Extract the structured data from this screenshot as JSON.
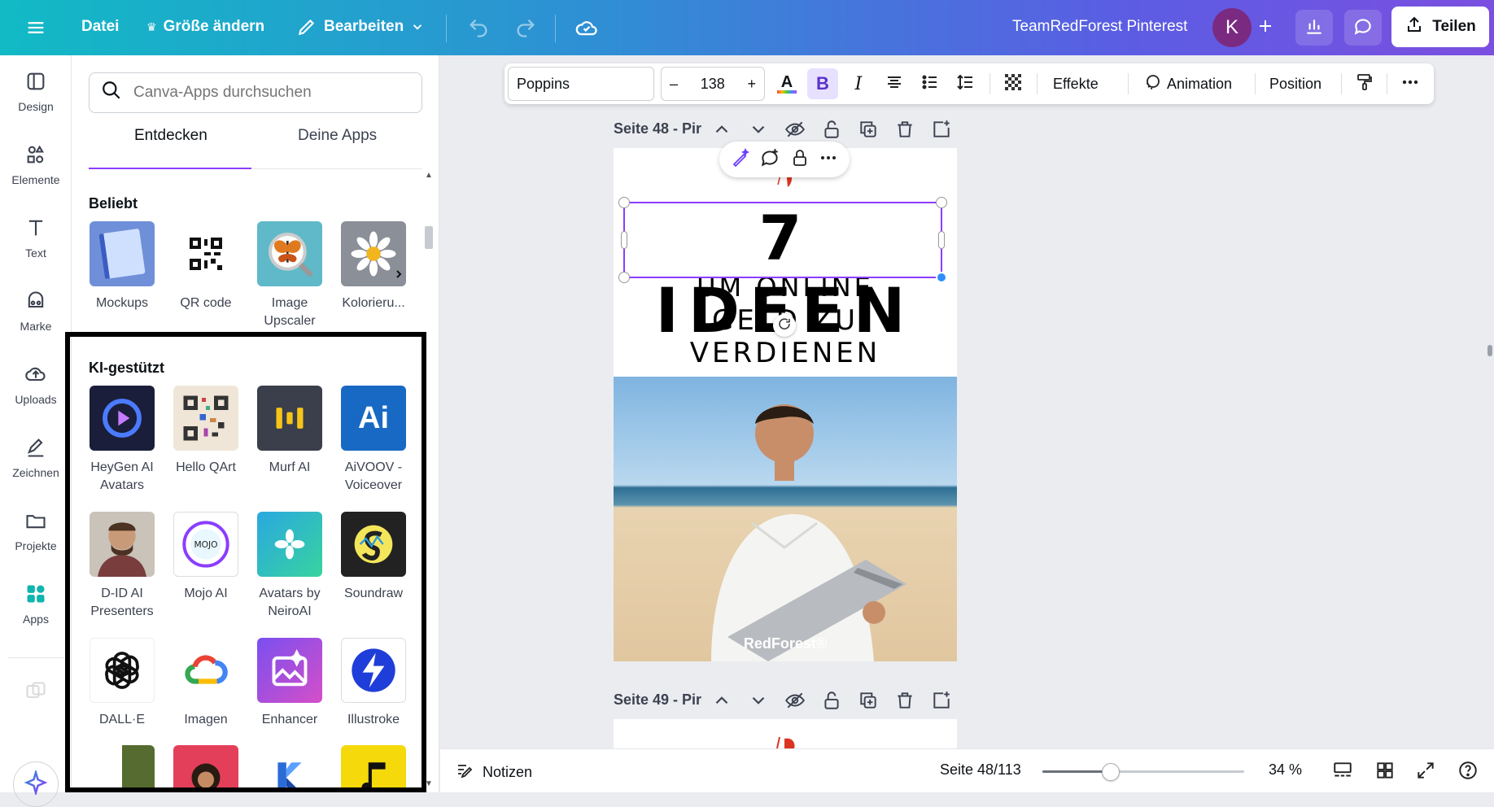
{
  "topbar": {
    "file_label": "Datei",
    "resize_label": "Größe ändern",
    "edit_label": "Bearbeiten",
    "project_title": "TeamRedForest Pinterest",
    "avatar_initial": "K",
    "share_label": "Teilen"
  },
  "rail": {
    "items": [
      {
        "label": "Design",
        "icon": "layout-icon"
      },
      {
        "label": "Elemente",
        "icon": "shapes-icon"
      },
      {
        "label": "Text",
        "icon": "text-icon"
      },
      {
        "label": "Marke",
        "icon": "brand-icon"
      },
      {
        "label": "Uploads",
        "icon": "upload-cloud-icon"
      },
      {
        "label": "Zeichnen",
        "icon": "pen-icon"
      },
      {
        "label": "Projekte",
        "icon": "folder-icon"
      },
      {
        "label": "Apps",
        "icon": "apps-icon"
      }
    ]
  },
  "panel": {
    "search_placeholder": "Canva-Apps durchsuchen",
    "tabs": [
      "Entdecken",
      "Deine Apps"
    ],
    "popular_title": "Beliebt",
    "popular_apps": [
      "Mockups",
      "QR code",
      "Image Upscaler",
      "Kolorieru..."
    ],
    "ai_title": "KI-gestützt",
    "ai_apps": [
      "HeyGen AI Avatars",
      "Hello QArt",
      "Murf AI",
      "AiVOOV - Voiceover",
      "D-ID AI Presenters",
      "Mojo AI",
      "Avatars by NeiroAI",
      "Soundraw",
      "DALL·E",
      "Imagen",
      "Enhancer",
      "Illustroke"
    ]
  },
  "format_toolbar": {
    "font": "Poppins",
    "font_size": "138",
    "effects_label": "Effekte",
    "animation_label": "Animation",
    "position_label": "Position"
  },
  "pages": {
    "page48_label": "Seite 48 - Pir",
    "page49_label": "Seite 49 - Pir",
    "headline": "7 IDEEN",
    "subline1": "UM ONLINE",
    "subline2": "GELD ZU VERDIENEN",
    "watermark": "RedForest®"
  },
  "bottombar": {
    "notes_label": "Notizen",
    "page_indicator": "Seite 48/113",
    "zoom": "34 %",
    "zoom_fraction": 0.34
  }
}
